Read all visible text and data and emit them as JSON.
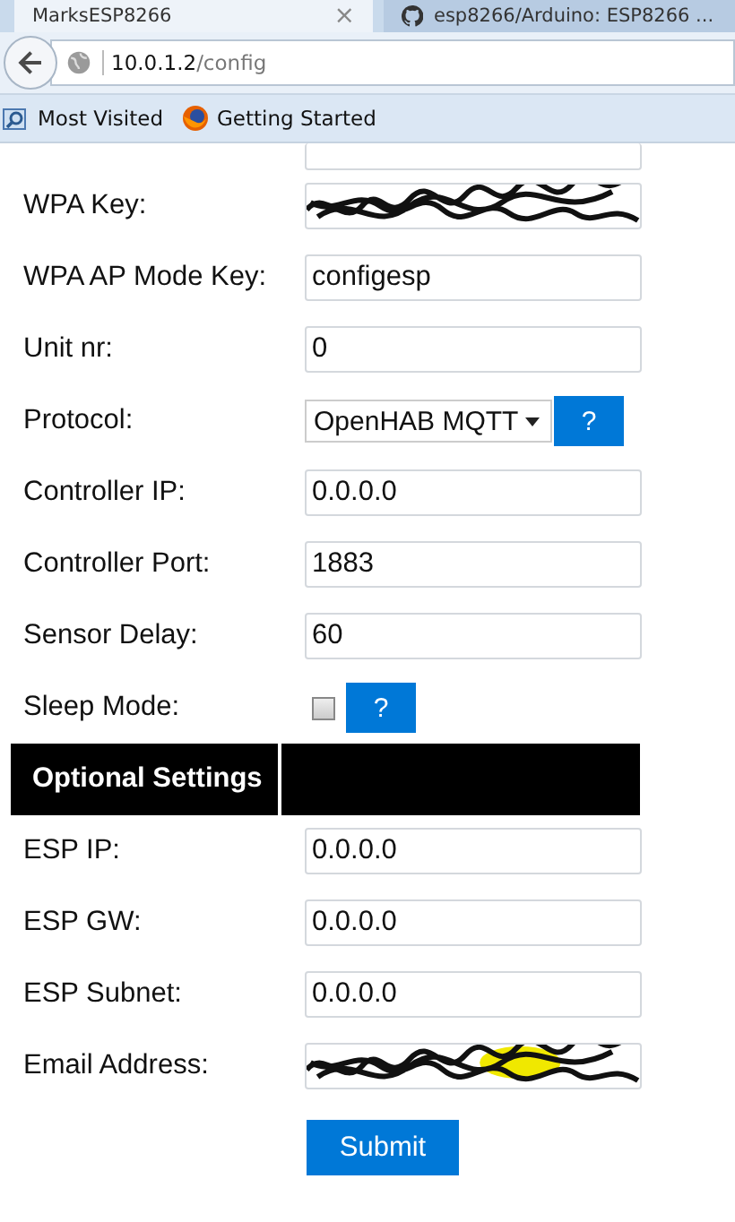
{
  "browser": {
    "tabs": [
      {
        "title": "MarksESP8266",
        "close": "×",
        "selected": true
      },
      {
        "title": "esp8266/Arduino: ESP8266 ...",
        "selected": false
      }
    ],
    "address": {
      "host": "10.0.1.2",
      "path": "/config"
    },
    "bookmarks": [
      {
        "label": "Most Visited",
        "kind": "folder"
      },
      {
        "label": "Getting Started",
        "kind": "firefox"
      }
    ]
  },
  "form": {
    "rows": [
      {
        "kind": "scribbled",
        "label": "WPA Key:"
      },
      {
        "kind": "input",
        "label": "WPA AP Mode Key:",
        "value": "configesp"
      },
      {
        "kind": "input",
        "label": "Unit nr:",
        "value": "0"
      },
      {
        "kind": "select",
        "label": "Protocol:",
        "value": "OpenHAB MQTT",
        "help": "?"
      },
      {
        "kind": "input",
        "label": "Controller IP:",
        "value": "0.0.0.0"
      },
      {
        "kind": "input",
        "label": "Controller Port:",
        "value": "1883"
      },
      {
        "kind": "input",
        "label": "Sensor Delay:",
        "value": "60"
      },
      {
        "kind": "checkbox",
        "label": "Sleep Mode:",
        "checked": false,
        "help": "?"
      },
      {
        "kind": "header",
        "label": "Optional Settings"
      },
      {
        "kind": "input",
        "label": "ESP IP:",
        "value": "0.0.0.0"
      },
      {
        "kind": "input",
        "label": "ESP GW:",
        "value": "0.0.0.0"
      },
      {
        "kind": "input",
        "label": "ESP Subnet:",
        "value": "0.0.0.0"
      },
      {
        "kind": "scribbled",
        "label": "Email Address:"
      }
    ],
    "submit": "Submit"
  }
}
